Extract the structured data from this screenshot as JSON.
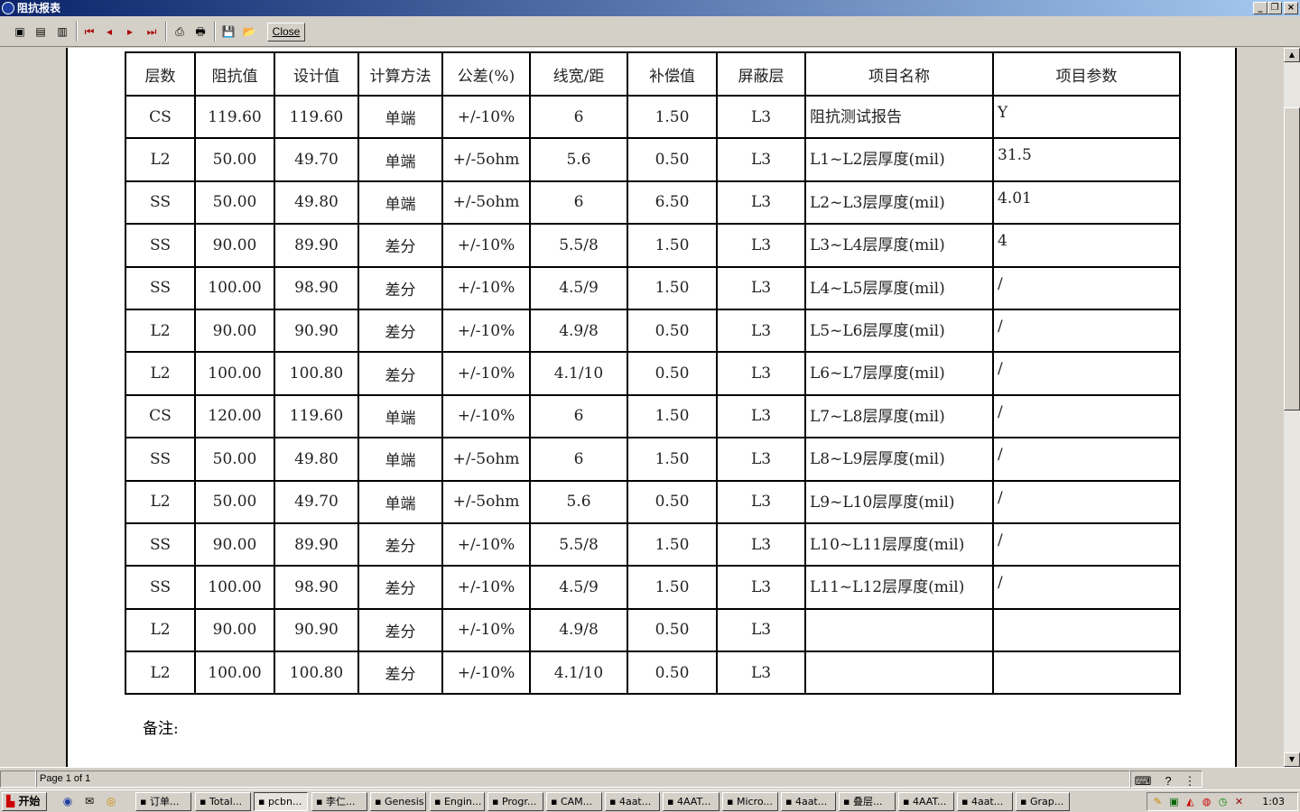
{
  "window": {
    "title": "阻抗报表"
  },
  "toolbar": {
    "buttons": [
      {
        "name": "view-single-page-icon",
        "glyph": "▣"
      },
      {
        "name": "view-multi-page-icon",
        "glyph": "▤"
      },
      {
        "name": "view-fit-icon",
        "glyph": "▥"
      },
      {
        "name": "first-page-icon",
        "glyph": "⏮"
      },
      {
        "name": "prev-page-icon",
        "glyph": "◂"
      },
      {
        "name": "next-page-icon",
        "glyph": "▸"
      },
      {
        "name": "last-page-icon",
        "glyph": "⏭"
      },
      {
        "name": "print-setup-icon",
        "glyph": "⎙"
      },
      {
        "name": "print-icon",
        "glyph": "🖶"
      },
      {
        "name": "save-icon",
        "glyph": "💾"
      },
      {
        "name": "open-icon",
        "glyph": "📂"
      }
    ],
    "close_label": "Close"
  },
  "report": {
    "headers": [
      "层数",
      "阻抗值",
      "设计值",
      "计算方法",
      "公差(%)",
      "线宽/距",
      "补偿值",
      "屏蔽层",
      "项目名称",
      "项目参数"
    ],
    "rows": [
      [
        "CS",
        "119.60",
        "119.60",
        "单端",
        "+/-10%",
        "6",
        "1.50",
        "L3",
        "阻抗测试报告",
        "Y"
      ],
      [
        "L2",
        "50.00",
        "49.70",
        "单端",
        "+/-5ohm",
        "5.6",
        "0.50",
        "L3",
        "L1~L2层厚度(mil)",
        "31.5"
      ],
      [
        "SS",
        "50.00",
        "49.80",
        "单端",
        "+/-5ohm",
        "6",
        "6.50",
        "L3",
        "L2~L3层厚度(mil)",
        "4.01"
      ],
      [
        "SS",
        "90.00",
        "89.90",
        "差分",
        "+/-10%",
        "5.5/8",
        "1.50",
        "L3",
        "L3~L4层厚度(mil)",
        "4"
      ],
      [
        "SS",
        "100.00",
        "98.90",
        "差分",
        "+/-10%",
        "4.5/9",
        "1.50",
        "L3",
        "L4~L5层厚度(mil)",
        "/"
      ],
      [
        "L2",
        "90.00",
        "90.90",
        "差分",
        "+/-10%",
        "4.9/8",
        "0.50",
        "L3",
        "L5~L6层厚度(mil)",
        "/"
      ],
      [
        "L2",
        "100.00",
        "100.80",
        "差分",
        "+/-10%",
        "4.1/10",
        "0.50",
        "L3",
        "L6~L7层厚度(mil)",
        "/"
      ],
      [
        "CS",
        "120.00",
        "119.60",
        "单端",
        "+/-10%",
        "6",
        "1.50",
        "L3",
        "L7~L8层厚度(mil)",
        "/"
      ],
      [
        "SS",
        "50.00",
        "49.80",
        "单端",
        "+/-5ohm",
        "6",
        "1.50",
        "L3",
        "L8~L9层厚度(mil)",
        "/"
      ],
      [
        "L2",
        "50.00",
        "49.70",
        "单端",
        "+/-5ohm",
        "5.6",
        "0.50",
        "L3",
        "L9~L10层厚度(mil)",
        "/"
      ],
      [
        "SS",
        "90.00",
        "89.90",
        "差分",
        "+/-10%",
        "5.5/8",
        "1.50",
        "L3",
        "L10~L11层厚度(mil)",
        "/"
      ],
      [
        "SS",
        "100.00",
        "98.90",
        "差分",
        "+/-10%",
        "4.5/9",
        "1.50",
        "L3",
        "L11~L12层厚度(mil)",
        "/"
      ],
      [
        "L2",
        "90.00",
        "90.90",
        "差分",
        "+/-10%",
        "4.9/8",
        "0.50",
        "L3",
        "",
        ""
      ],
      [
        "L2",
        "100.00",
        "100.80",
        "差分",
        "+/-10%",
        "4.1/10",
        "0.50",
        "L3",
        "",
        ""
      ]
    ],
    "remark_label": "备注:"
  },
  "statusbar": {
    "page_info": "Page 1 of 1"
  },
  "taskbar": {
    "start_label": "开始",
    "tasks": [
      {
        "label": "订单...",
        "active": false
      },
      {
        "label": "Total...",
        "active": false
      },
      {
        "label": "pcbn...",
        "active": true
      },
      {
        "label": "李仁...",
        "active": false
      },
      {
        "label": "Genesis",
        "active": false
      },
      {
        "label": "Engin...",
        "active": false
      },
      {
        "label": "Progr...",
        "active": false
      },
      {
        "label": "CAM...",
        "active": false
      },
      {
        "label": "4aat...",
        "active": false
      },
      {
        "label": "4AAT...",
        "active": false
      },
      {
        "label": "Micro...",
        "active": false
      },
      {
        "label": "4aat...",
        "active": false
      },
      {
        "label": "叠层...",
        "active": false
      },
      {
        "label": "4AAT...",
        "active": false
      },
      {
        "label": "4aat...",
        "active": false
      },
      {
        "label": "Grap...",
        "active": false
      }
    ],
    "clock": "1:03"
  }
}
